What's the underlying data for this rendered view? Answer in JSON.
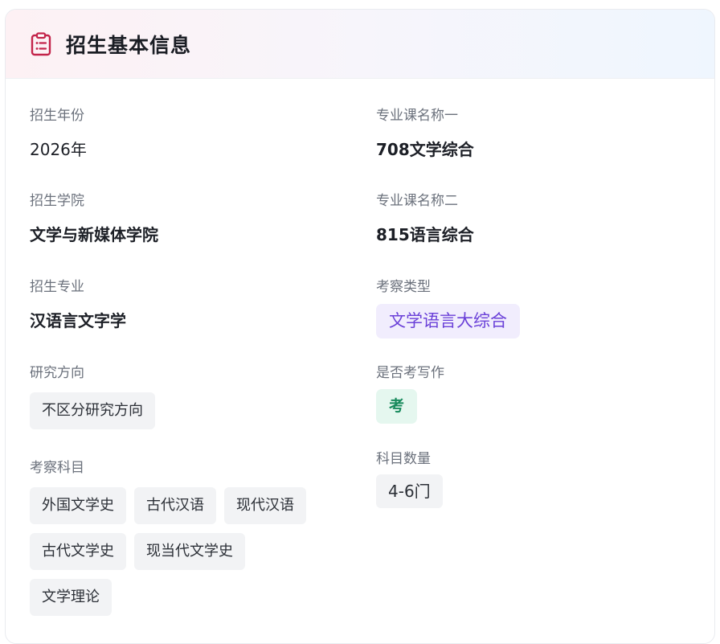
{
  "header": {
    "icon": "clipboard-list-icon",
    "title": "招生基本信息",
    "accent_color": "#c3244a"
  },
  "left": {
    "year": {
      "label": "招生年份",
      "value": "2026年"
    },
    "college": {
      "label": "招生学院",
      "value": "文学与新媒体学院"
    },
    "major": {
      "label": "招生专业",
      "value": "汉语言文字学"
    },
    "direction": {
      "label": "研究方向",
      "value": "不区分研究方向"
    },
    "subjects": {
      "label": "考察科目",
      "items": [
        "外国文学史",
        "古代汉语",
        "现代汉语",
        "古代文学史",
        "现当代文学史",
        "文学理论"
      ]
    }
  },
  "right": {
    "course1": {
      "label": "专业课名称一",
      "value": "708文学综合"
    },
    "course2": {
      "label": "专业课名称二",
      "value": "815语言综合"
    },
    "exam_type": {
      "label": "考察类型",
      "value": "文学语言大综合",
      "color": "#6a40d8"
    },
    "writing": {
      "label": "是否考写作",
      "value": "考",
      "color": "#178a5c"
    },
    "subject_count": {
      "label": "科目数量",
      "value": "4-6门"
    }
  }
}
